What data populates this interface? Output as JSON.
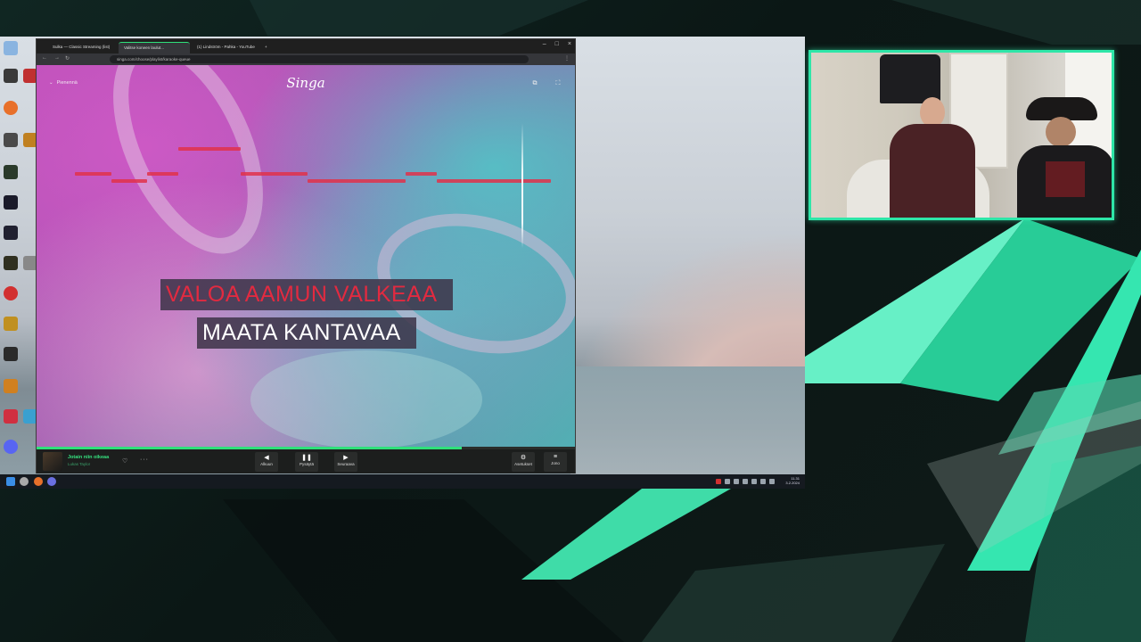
{
  "browser": {
    "tabs": [
      {
        "label": "Sulka — Classic Streaming (list)"
      },
      {
        "label": "Valitse koneen laulut..."
      },
      {
        "label": "(1) Lindström - Pahka - YouTube"
      }
    ],
    "url": "singa.com/choose/playlist/karaoke-queue"
  },
  "singa": {
    "logo": "Singa",
    "collapse_label": "Pienennä",
    "lyrics": {
      "line1": "VALOA AAMUN VALKEAA",
      "line2": "MAATA KANTAVAA"
    },
    "pitch_bars": [
      {
        "row": 0,
        "start": 0.24,
        "end": 0.36
      },
      {
        "row": 1,
        "start": 0.04,
        "end": 0.11
      },
      {
        "row": 1,
        "start": 0.18,
        "end": 0.24
      },
      {
        "row": 1,
        "start": 0.36,
        "end": 0.49
      },
      {
        "row": 1,
        "start": 0.68,
        "end": 0.74
      },
      {
        "row": 2,
        "start": 0.11,
        "end": 0.18
      },
      {
        "row": 2,
        "start": 0.49,
        "end": 0.68
      },
      {
        "row": 2,
        "start": 0.74,
        "end": 0.96
      }
    ],
    "player": {
      "song_title": "Jotain niin oikeaa",
      "artist": "Lukas Taylor",
      "progress": 0.79,
      "controls": {
        "prev": "Alkuun",
        "pause": "Pysäytä",
        "next": "Seuraava",
        "settings": "Asetukset",
        "queue": "Jono"
      }
    }
  },
  "taskbar": {
    "clock_time": "11.31",
    "clock_date": "3.2.2024"
  },
  "colors": {
    "accent": "#2ee6a8",
    "lyric_sung": "#e22a40",
    "lyric_unsung": "#ffffff",
    "progress": "#2fe07a"
  }
}
